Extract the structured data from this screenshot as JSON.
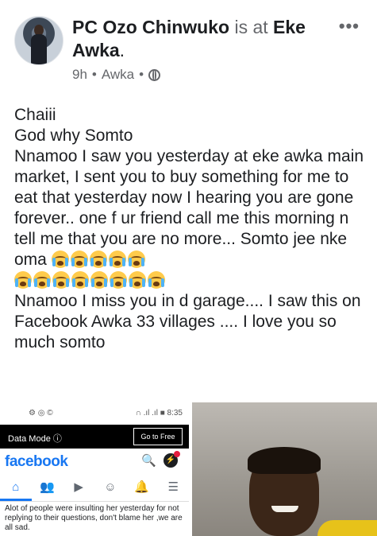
{
  "post": {
    "author": "PC Ozo Chinwuko",
    "connector": " is at ",
    "place_line1": "Eke",
    "place_line2": "Awka",
    "period": ".",
    "time": "9h",
    "location": "Awka",
    "sep": "•",
    "more": "•••",
    "lines": [
      "Chaiii",
      "God why Somto",
      "Nnamoo I saw you yesterday at eke awka main market, I sent you to buy something for me to eat that yesterday now I hearing you are gone forever.. one f ur friend call me this morning n tell me that you are no more... Somto jee nke oma"
    ],
    "tail_text": "Nnamoo I miss you in d garage.... I saw this on Facebook Awka 33 villages .... I love you so much somto",
    "emoji_name": "loudly-crying-face",
    "emoji_count_line1": 5,
    "emoji_count_line2": 8
  },
  "screenshot": {
    "status_left": "⚙ ◎ ©",
    "status_right": "∩ .ıl .ıl ■ 8:35",
    "data_mode": "Data Mode ⓘ",
    "go_free": "Go to Free",
    "logo": "facebook",
    "search_icon": "🔍",
    "messenger_icon": "⚡",
    "nav": [
      "⌂",
      "👥",
      "▶",
      "☺",
      "🔔",
      "☰"
    ],
    "snippet": "Alot of people were insulting her yesterday for not replying to their questions, don't blame her ,we are all sad."
  }
}
